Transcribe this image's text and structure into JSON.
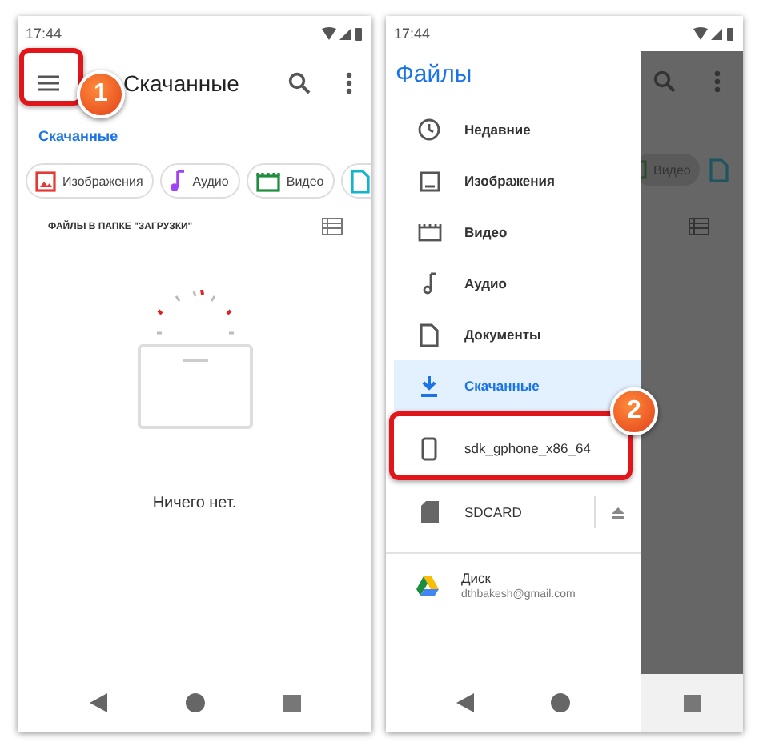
{
  "left_screen": {
    "status_time": "17:44",
    "menu_badge": "1",
    "title": "Скачанные",
    "breadcrumb": "Скачанные",
    "chips": [
      {
        "label": "Изображения",
        "color": "#e53935"
      },
      {
        "label": "Аудио",
        "color": "#a142f4"
      },
      {
        "label": "Видео",
        "color": "#1e8e3e"
      },
      {
        "color": "#12b5cb"
      }
    ],
    "section_header": "ФАЙЛЫ В ПАПКЕ \"ЗАГРУЗКИ\"",
    "empty_message": "Ничего нет."
  },
  "right_screen": {
    "status_time": "17:44",
    "behind_chip": "Видео",
    "drawer": {
      "title": "Файлы",
      "items": [
        {
          "label": "Недавние",
          "selected": false
        },
        {
          "label": "Изображения",
          "selected": false
        },
        {
          "label": "Видео",
          "selected": false
        },
        {
          "label": "Аудио",
          "selected": false
        },
        {
          "label": "Документы",
          "selected": false
        },
        {
          "label": "Скачанные",
          "selected": true
        }
      ],
      "devices": [
        {
          "label": "sdk_gphone_x86_64",
          "badge": "2"
        },
        {
          "label": "SDCARD",
          "ejectable": true
        }
      ],
      "accounts": [
        {
          "label": "Диск",
          "subtitle": "dthbakesh@gmail.com"
        }
      ]
    }
  }
}
